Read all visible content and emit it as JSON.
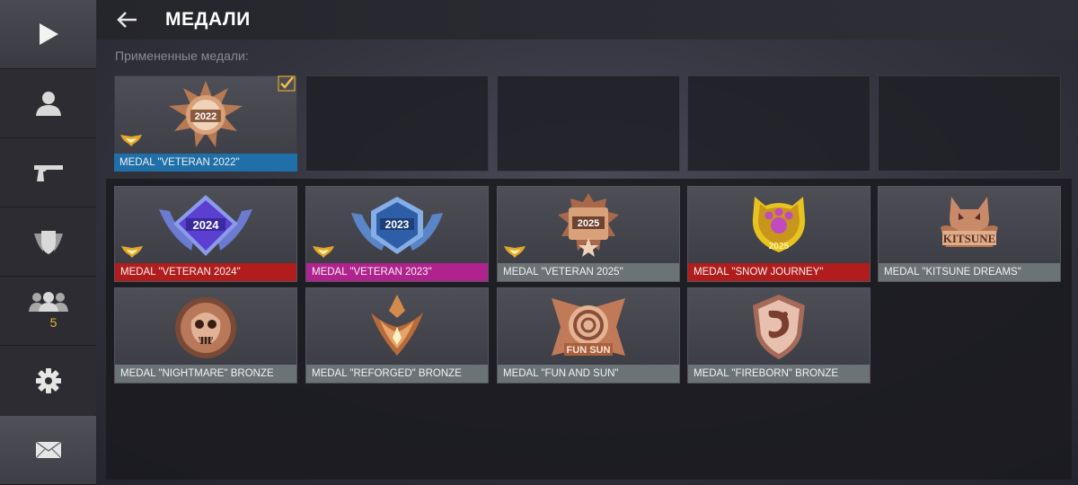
{
  "header": {
    "title": "МЕДАЛИ"
  },
  "applied_label": "Примененные медали:",
  "sidebar": {
    "friends_count": "5"
  },
  "applied_slots": [
    {
      "label": "MEDAL \"VETERAN 2022\"",
      "color": "#1f6fa8",
      "year": "2022",
      "checked": true
    }
  ],
  "medals": [
    {
      "label": "MEDAL \"VETERAN 2024\"",
      "color": "#b11c1c",
      "year": "2024"
    },
    {
      "label": "MEDAL \"VETERAN 2023\"",
      "color": "#b0238e",
      "year": "2023"
    },
    {
      "label": "MEDAL \"VETERAN 2025\"",
      "color": "#6b7377",
      "year": "2025"
    },
    {
      "label": "MEDAL \"SNOW JOURNEY\"",
      "color": "#b11c1c",
      "year": "2025"
    },
    {
      "label": "MEDAL \"KITSUNE DREAMS\"",
      "color": "#6b7377",
      "text": "KITSUNE"
    },
    {
      "label": "MEDAL \"NIGHTMARE\" BRONZE",
      "color": "#6b7377"
    },
    {
      "label": "MEDAL \"REFORGED\" BRONZE",
      "color": "#6b7377"
    },
    {
      "label": "MEDAL \"FUN AND SUN\"",
      "color": "#6b7377",
      "text": "FUN SUN"
    },
    {
      "label": "MEDAL \"FIREBORN\" BRONZE",
      "color": "#6b7377"
    }
  ]
}
